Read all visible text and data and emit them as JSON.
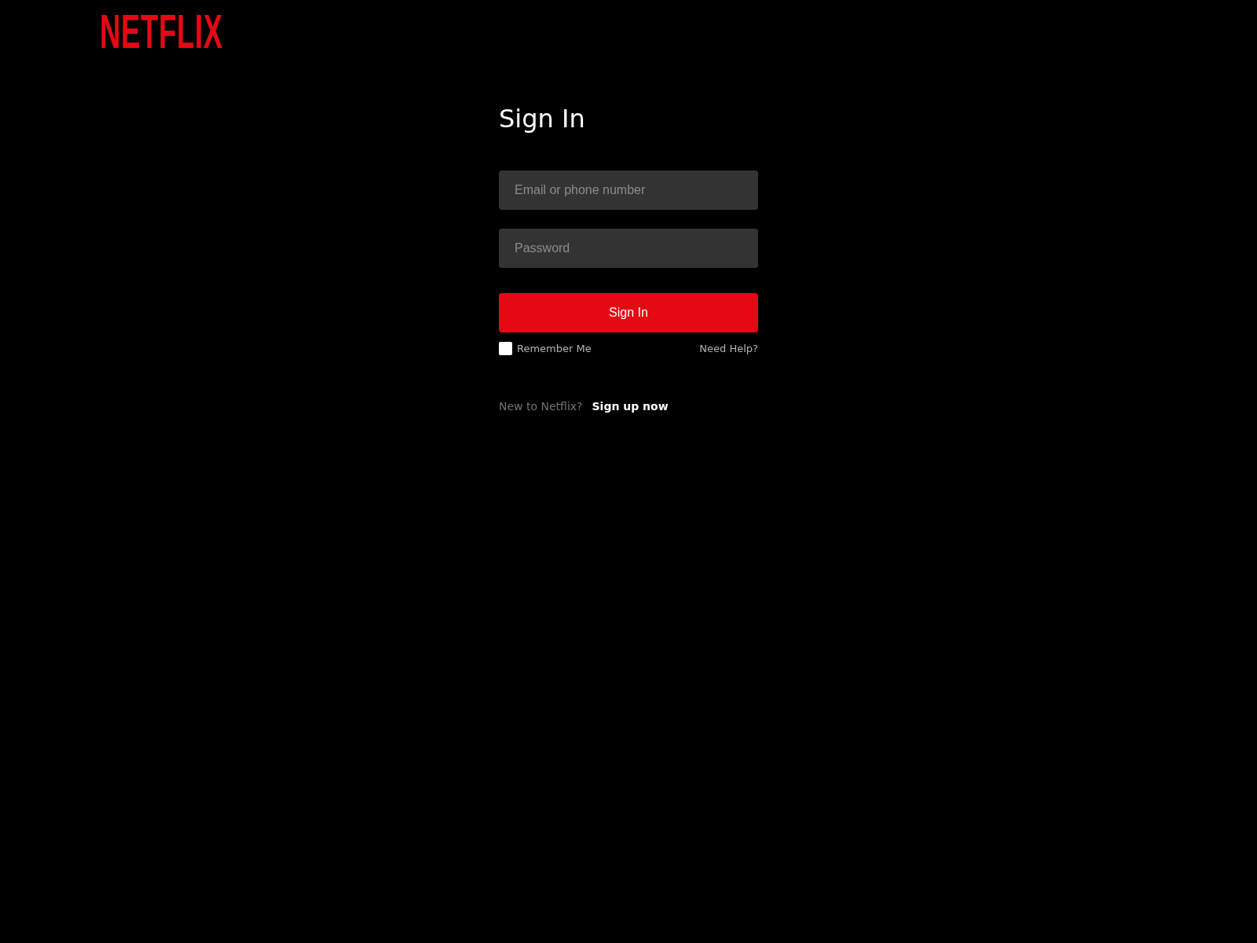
{
  "header": {
    "logo": "NETFLIX"
  },
  "form": {
    "title": "Sign In",
    "fields": [
      {
        "placeholder": "Email or phone number"
      },
      {
        "placeholder": "Password"
      }
    ],
    "submit": "Sign In",
    "remember": {
      "label": "Remember Me",
      "checked": false
    },
    "help": "Need Help?",
    "signup": {
      "prompt": "New to Netflix?",
      "link": "Sign up now"
    }
  }
}
